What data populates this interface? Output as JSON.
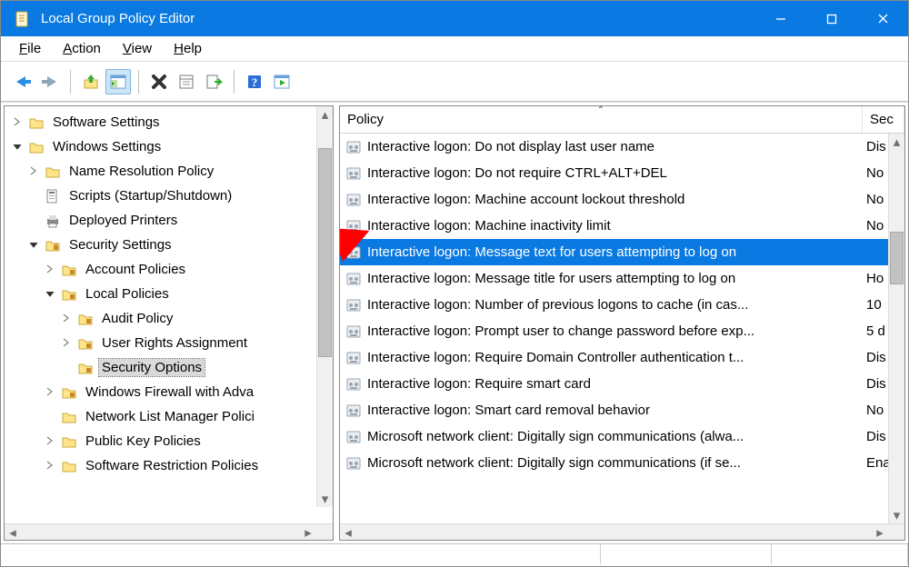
{
  "window": {
    "title": "Local Group Policy Editor"
  },
  "menus": {
    "file": "File",
    "action": "Action",
    "view": "View",
    "help": "Help"
  },
  "tree": {
    "sw_settings": "Software Settings",
    "win_settings": "Windows Settings",
    "name_res": "Name Resolution Policy",
    "scripts": "Scripts (Startup/Shutdown)",
    "printers": "Deployed Printers",
    "security": "Security Settings",
    "acct_pol": "Account Policies",
    "local_pol": "Local Policies",
    "audit": "Audit Policy",
    "user_rights": "User Rights Assignment",
    "sec_opts": "Security Options",
    "firewall": "Windows Firewall with Adva",
    "netlist": "Network List Manager Polici",
    "pubkey": "Public Key Policies",
    "srp": "Software Restriction Policies"
  },
  "list": {
    "header_policy": "Policy",
    "header_sec": "Sec",
    "rows": [
      {
        "policy": "Interactive logon: Do not display last user name",
        "setting": "Dis"
      },
      {
        "policy": "Interactive logon: Do not require CTRL+ALT+DEL",
        "setting": "No"
      },
      {
        "policy": "Interactive logon: Machine account lockout threshold",
        "setting": "No"
      },
      {
        "policy": "Interactive logon: Machine inactivity limit",
        "setting": "No"
      },
      {
        "policy": "Interactive logon: Message text for users attempting to log on",
        "setting": ""
      },
      {
        "policy": "Interactive logon: Message title for users attempting to log on",
        "setting": "Ho"
      },
      {
        "policy": "Interactive logon: Number of previous logons to cache (in cas...",
        "setting": "10"
      },
      {
        "policy": "Interactive logon: Prompt user to change password before exp...",
        "setting": "5 d"
      },
      {
        "policy": "Interactive logon: Require Domain Controller authentication t...",
        "setting": "Dis"
      },
      {
        "policy": "Interactive logon: Require smart card",
        "setting": "Dis"
      },
      {
        "policy": "Interactive logon: Smart card removal behavior",
        "setting": "No"
      },
      {
        "policy": "Microsoft network client: Digitally sign communications (alwa...",
        "setting": "Dis"
      },
      {
        "policy": "Microsoft network client: Digitally sign communications (if se...",
        "setting": "Ena"
      }
    ],
    "selected_index": 4
  }
}
